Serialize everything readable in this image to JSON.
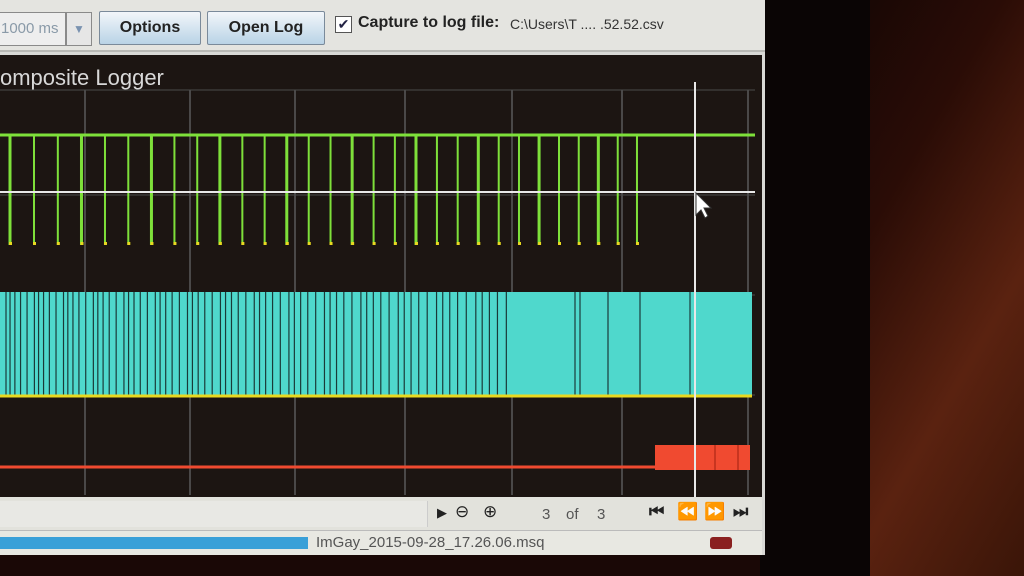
{
  "toolbar": {
    "interval_value": "1000 ms",
    "options_label": "Options",
    "open_log_label": "Open Log",
    "capture_checked": "✔",
    "capture_label": "Capture to log file:",
    "log_path": "C:\\Users\\T .... .52.52.csv"
  },
  "graph": {
    "title": "omposite Logger"
  },
  "pager": {
    "current": "3",
    "of": "of",
    "total": "3"
  },
  "status": {
    "file": "ImGay_2015-09-28_17.26.06.msq"
  },
  "colors": {
    "green": "#7ee03a",
    "cyan": "#4fd8cc",
    "red": "#f04a30",
    "yellow": "#e8d820"
  }
}
